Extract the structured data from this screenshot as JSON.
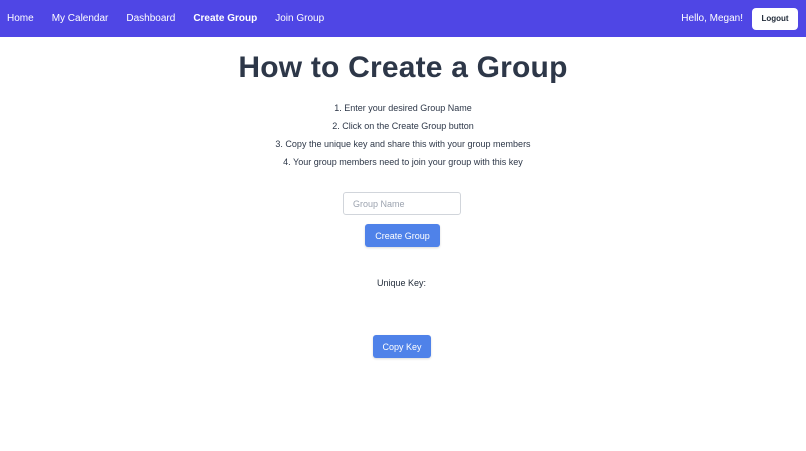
{
  "nav": {
    "links": [
      {
        "label": "Home"
      },
      {
        "label": "My Calendar"
      },
      {
        "label": "Dashboard"
      },
      {
        "label": "Create Group",
        "active": true
      },
      {
        "label": "Join Group"
      }
    ],
    "greeting": "Hello, Megan!",
    "logout_label": "Logout",
    "background_color": "#4f46e5"
  },
  "main": {
    "title": "How to Create a Group",
    "steps": [
      "1. Enter your desired Group Name",
      "2. Click on the Create Group button",
      "3. Copy the unique key and share this with your group members",
      "4. Your group members need to join your group with this key"
    ],
    "group_name_input": {
      "value": "",
      "placeholder": "Group Name"
    },
    "create_button_label": "Create Group",
    "unique_key_label": "Unique Key:",
    "unique_key_value": "",
    "copy_button_label": "Copy Key",
    "button_color": "#4f82e9"
  }
}
